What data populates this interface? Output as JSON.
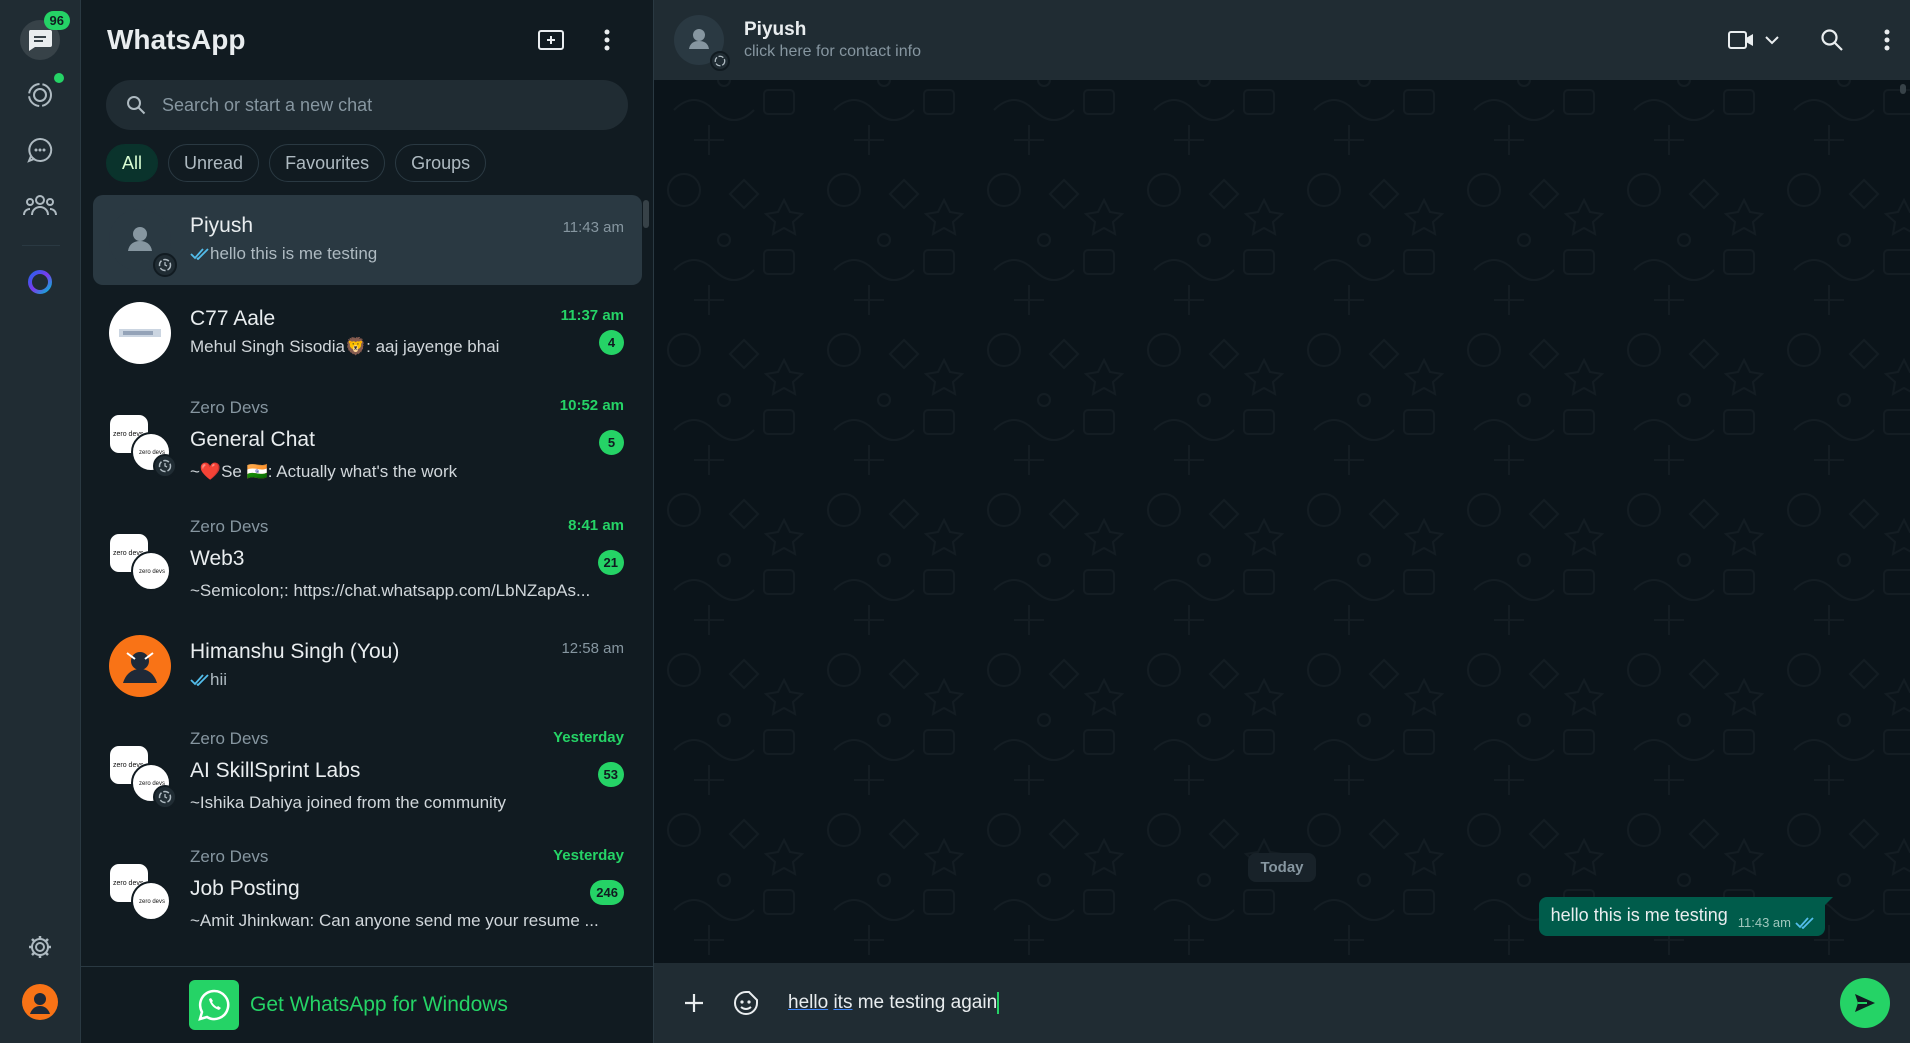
{
  "rail": {
    "chats_badge": "96"
  },
  "sidebar": {
    "title": "WhatsApp",
    "search_placeholder": "Search or start a new chat",
    "filters": [
      "All",
      "Unread",
      "Favourites",
      "Groups"
    ],
    "chats": [
      {
        "group": "",
        "name": "Piyush",
        "time": "11:43 am",
        "preview": "hello this is me testing",
        "unread": "",
        "ticks": true
      },
      {
        "group": "",
        "name": "C77 Aale",
        "time": "11:37 am",
        "preview": "Mehul Singh Sisodia🦁: aaj jayenge bhai",
        "unread": "4",
        "ticks": false
      },
      {
        "group": "Zero Devs",
        "name": "General Chat",
        "time": "10:52 am",
        "preview": "~❤️Se 🇮🇳: Actually what's the work",
        "unread": "5",
        "ticks": false
      },
      {
        "group": "Zero Devs",
        "name": "Web3",
        "time": "8:41 am",
        "preview": "~Semicolon;: https://chat.whatsapp.com/LbNZapAs...",
        "unread": "21",
        "ticks": false
      },
      {
        "group": "",
        "name": "Himanshu Singh (You)",
        "time": "12:58 am",
        "preview": "hii",
        "unread": "",
        "ticks": true
      },
      {
        "group": "Zero Devs",
        "name": "AI SkillSprint Labs",
        "time": "Yesterday",
        "preview": "~Ishika Dahiya joined from the community",
        "unread": "53",
        "ticks": false
      },
      {
        "group": "Zero Devs",
        "name": "Job Posting",
        "time": "Yesterday",
        "preview": "~Amit Jhinkwan: Can anyone send me your resume ...",
        "unread": "246",
        "ticks": false
      }
    ],
    "get_app_label": "Get WhatsApp for Windows"
  },
  "conversation": {
    "name": "Piyush",
    "subtitle": "click here for contact info",
    "date_label": "Today",
    "messages": [
      {
        "text": "hello this is me testing",
        "time": "11:43 am",
        "outgoing": true,
        "read": true
      }
    ],
    "draft_part1": "hello",
    "draft_part2": "its",
    "draft_part3": "me testing again"
  },
  "colors": {
    "accent": "#25d366",
    "panel": "#202c33",
    "background": "#111b21",
    "outgoing_bubble": "#005c4b"
  }
}
